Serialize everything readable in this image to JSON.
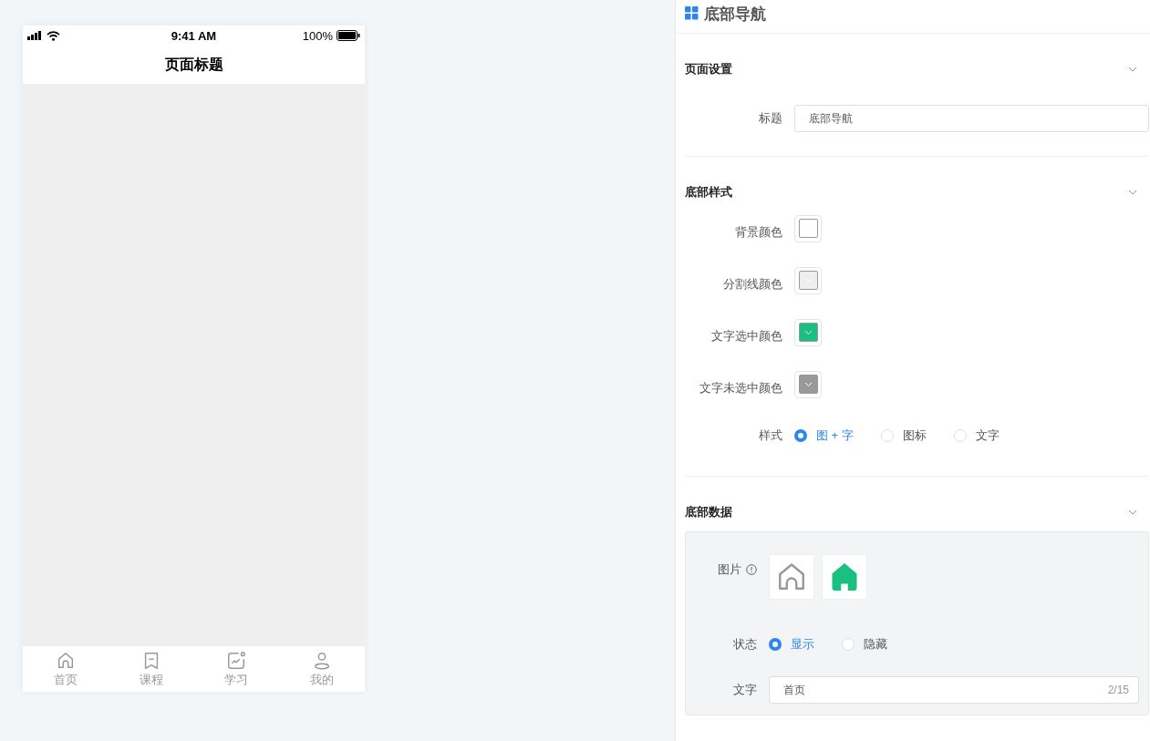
{
  "phone": {
    "status_bar": {
      "time": "9:41 AM",
      "battery": "100%"
    },
    "title": "页面标题",
    "tabs": [
      {
        "label": "首页",
        "kind": "home"
      },
      {
        "label": "课程",
        "kind": "bookmark"
      },
      {
        "label": "学习",
        "kind": "chart"
      },
      {
        "label": "我的",
        "kind": "user"
      }
    ]
  },
  "panel": {
    "title": "底部导航",
    "page_settings": {
      "title": "页面设置",
      "expanded": true,
      "fields": [
        {
          "label": "标题",
          "value": "底部导航"
        }
      ]
    },
    "bottom_style": {
      "title": "底部样式",
      "expanded": true,
      "colors": [
        {
          "label": "背景颜色",
          "color": "#ffffff"
        },
        {
          "label": "分割线颜色",
          "color": "#eeeeee"
        },
        {
          "label": "文字选中颜色",
          "color": "#19c082"
        },
        {
          "label": "文字未选中颜色",
          "color": "#999999"
        }
      ],
      "style": {
        "label": "样式",
        "options": [
          {
            "label": "图 + 字",
            "selected": true
          },
          {
            "label": "图标",
            "selected": false
          },
          {
            "label": "文字",
            "selected": false
          }
        ]
      }
    },
    "bottom_data": {
      "title": "底部数据",
      "expanded": true,
      "item": {
        "image_label": "图片",
        "images": [
          {
            "kind": "outline"
          },
          {
            "kind": "filled"
          }
        ],
        "status": {
          "label": "状态",
          "options": [
            {
              "label": "显示",
              "selected": true
            },
            {
              "label": "隐藏",
              "selected": false
            }
          ]
        },
        "text": {
          "label": "文字",
          "value": "首页",
          "count": "2/15"
        }
      }
    }
  }
}
